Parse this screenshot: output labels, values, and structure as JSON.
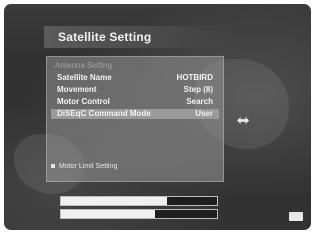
{
  "screen": {
    "title": "Satellite Setting",
    "subhead": "Antenna Setting",
    "rows": [
      {
        "label": "Satellite Name",
        "value": "HOTBIRD",
        "selected": false
      },
      {
        "label": "Movement",
        "value": "Step (8)",
        "selected": false
      },
      {
        "label": "Motor Control",
        "value": "Search",
        "selected": false
      },
      {
        "label": "DiSEqC Command Mode",
        "value": "User",
        "selected": true
      }
    ],
    "hint": "Motor Limit Setting",
    "signal_level": 0.68,
    "quality_level": 0.6
  }
}
